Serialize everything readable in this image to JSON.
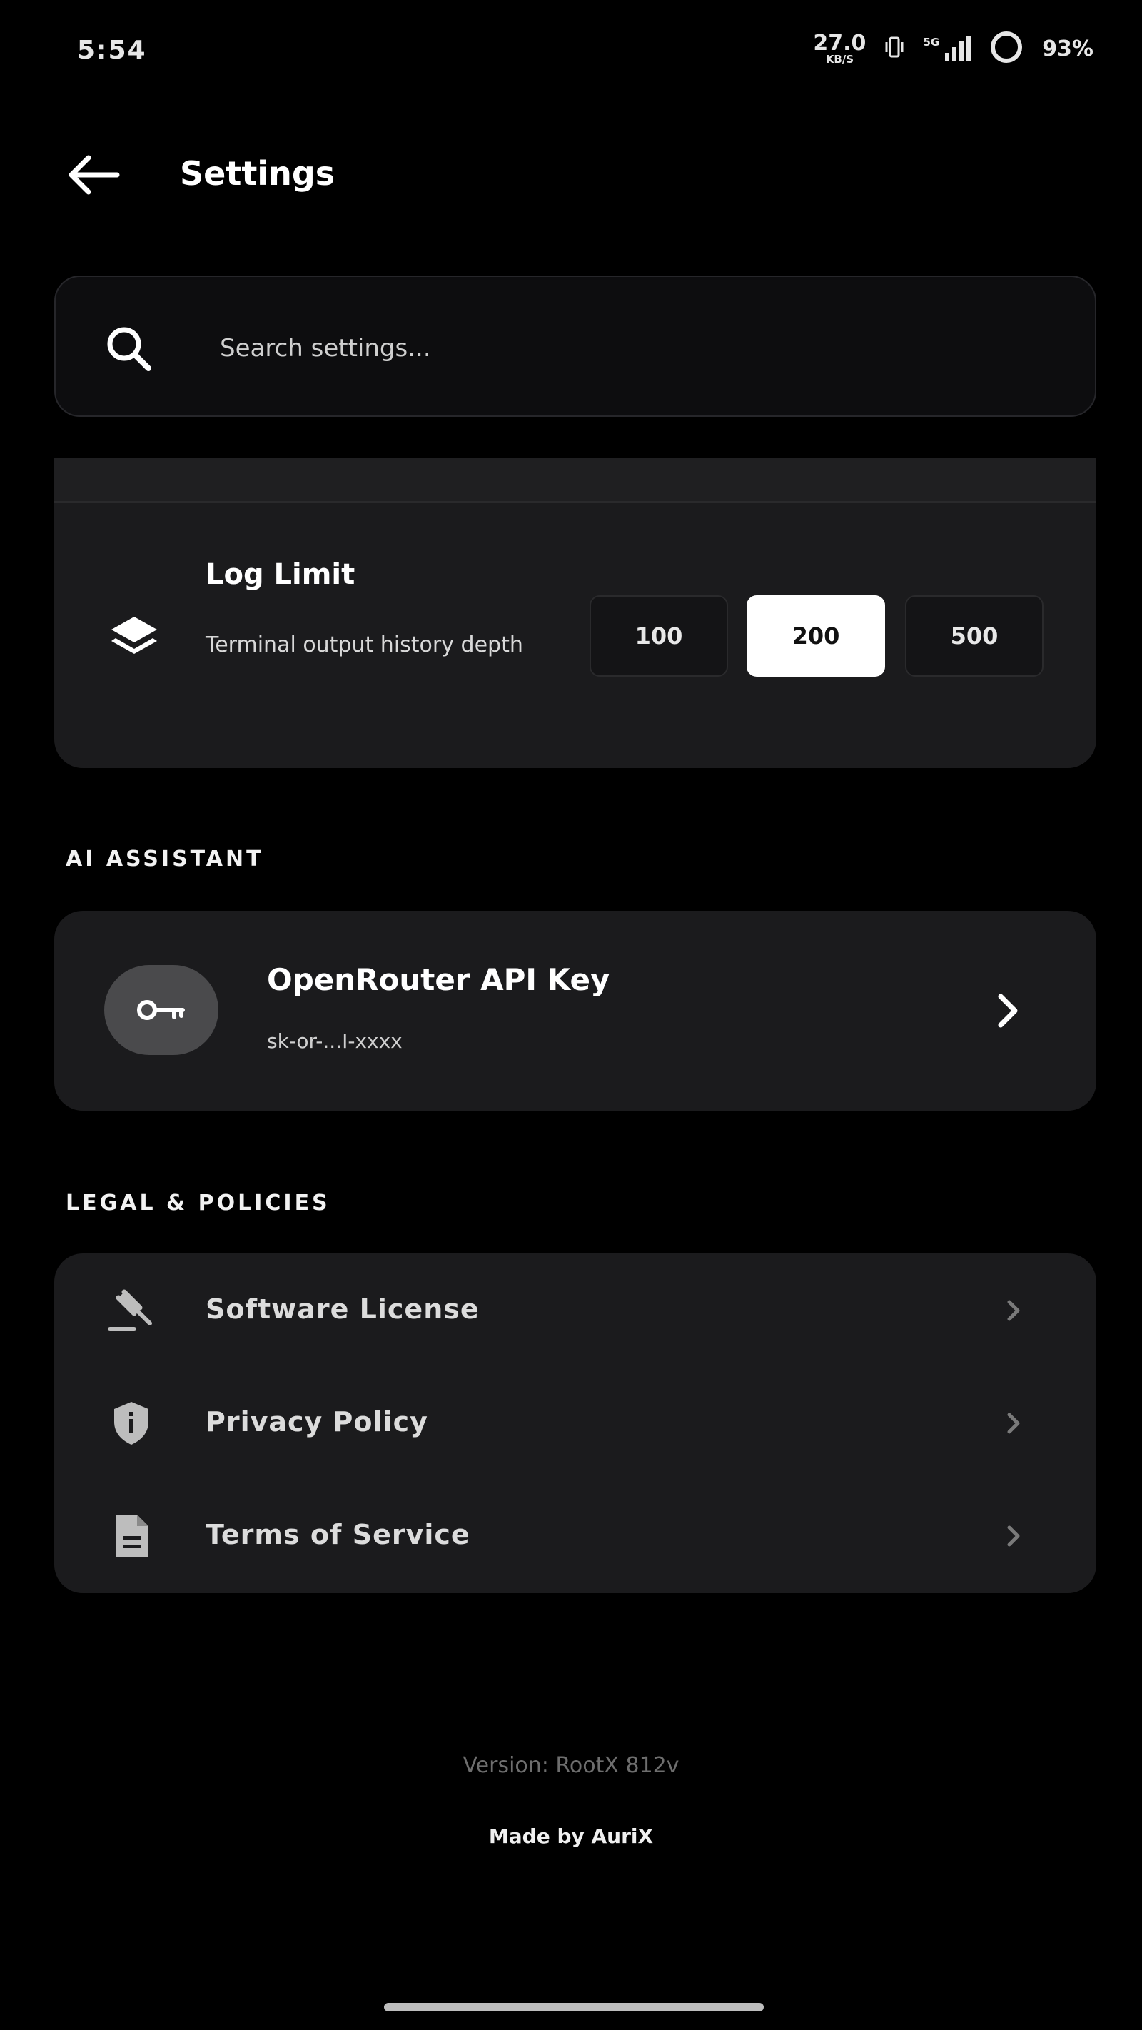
{
  "status_bar": {
    "time": "5:54",
    "net_speed_value": "27.0",
    "net_speed_unit": "KB/S",
    "signal_label": "5G",
    "battery_percent": "93%"
  },
  "header": {
    "back_icon": "arrow-left-icon",
    "title": "Settings"
  },
  "search": {
    "icon": "search-icon",
    "placeholder": "Search settings..."
  },
  "log_limit": {
    "icon": "layers-icon",
    "title": "Log Limit",
    "description": "Terminal output history depth",
    "options": [
      "100",
      "200",
      "500"
    ],
    "selected": "200"
  },
  "ai_assistant": {
    "section_label": "AI ASSISTANT",
    "item": {
      "icon": "key-icon",
      "title": "OpenRouter API Key",
      "subtitle": "sk-or-...I-xxxx",
      "chevron": "chevron-right-icon"
    }
  },
  "legal": {
    "section_label": "LEGAL & POLICIES",
    "items": [
      {
        "icon": "gavel-icon",
        "label": "Software License"
      },
      {
        "icon": "shield-info-icon",
        "label": "Privacy Policy"
      },
      {
        "icon": "document-icon",
        "label": "Terms of Service"
      }
    ]
  },
  "footer": {
    "version": "Version: RootX 812v",
    "made_by": "Made by AuriX"
  },
  "colors": {
    "background": "#000000",
    "card": "#1b1b1d",
    "selected_segment": "#ffffff",
    "muted_text": "#6e6e6e"
  }
}
